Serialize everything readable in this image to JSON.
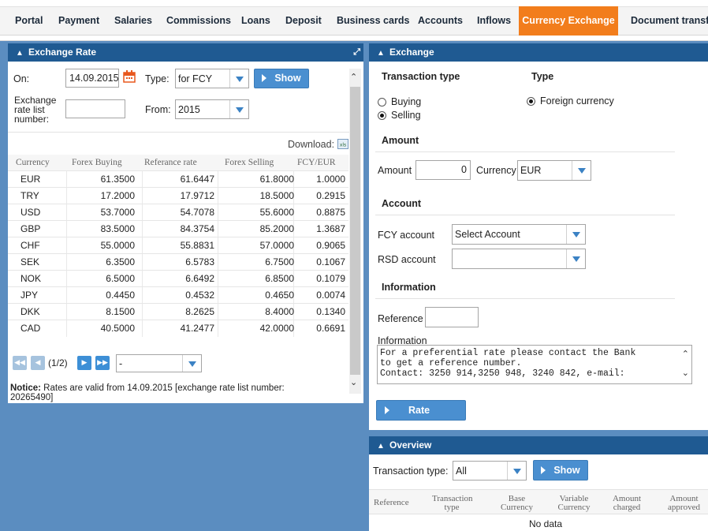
{
  "nav": {
    "items": [
      "Portal",
      "Payment",
      "Salaries",
      "Commissions",
      "Loans",
      "Deposit",
      "Business cards",
      "Accounts",
      "Inflows",
      "Currency Exchange",
      "Document transfer"
    ],
    "active": "Currency Exchange"
  },
  "exchange_rate": {
    "title": "Exchange Rate",
    "on_label": "On:",
    "date": "14.09.2015",
    "type_label": "Type:",
    "type_value": "for FCY",
    "show_label": "Show",
    "list_label_1": "Exchange",
    "list_label_2": "rate list",
    "list_label_3": "number:",
    "list_number": "",
    "from_label": "From:",
    "from_value": "2015",
    "download_label": "Download:",
    "columns": [
      "Currency",
      "Forex Buying",
      "Referance rate",
      "Forex Selling",
      "FCY/EUR"
    ],
    "rows": [
      [
        "EUR",
        "61.3500",
        "61.6447",
        "61.8000",
        "1.0000"
      ],
      [
        "TRY",
        "17.2000",
        "17.9712",
        "18.5000",
        "0.2915"
      ],
      [
        "USD",
        "53.7000",
        "54.7078",
        "55.6000",
        "0.8875"
      ],
      [
        "GBP",
        "83.5000",
        "84.3754",
        "85.2000",
        "1.3687"
      ],
      [
        "CHF",
        "55.0000",
        "55.8831",
        "57.0000",
        "0.9065"
      ],
      [
        "SEK",
        "6.3500",
        "6.5783",
        "6.7500",
        "0.1067"
      ],
      [
        "NOK",
        "6.5000",
        "6.6492",
        "6.8500",
        "0.1079"
      ],
      [
        "JPY",
        "0.4450",
        "0.4532",
        "0.4650",
        "0.0074"
      ],
      [
        "DKK",
        "8.1500",
        "8.2625",
        "8.4000",
        "0.1340"
      ],
      [
        "CAD",
        "40.5000",
        "41.2477",
        "42.0000",
        "0.6691"
      ]
    ],
    "pager_text": "(1/2)",
    "page_size": "-",
    "notice_bold": "Notice:",
    "notice_text_1": " Rates are valid from 14.09.2015 [exchange rate list number:",
    "notice_text_2": "20265490]"
  },
  "exchange": {
    "title": "Exchange",
    "transaction_type_label": "Transaction type",
    "type_label": "Type",
    "buying_label": "Buying",
    "selling_label": "Selling",
    "foreign_currency_label": "Foreign currency",
    "amount_section": "Amount",
    "amount_label": "Amount",
    "amount_value": "0",
    "currency_label": "Currency",
    "currency_value": "EUR",
    "account_section": "Account",
    "fcy_account_label": "FCY account",
    "fcy_account_value": "Select Account",
    "rsd_account_label": "RSD account",
    "rsd_account_value": "",
    "information_section": "Information",
    "reference_label": "Reference",
    "reference_value": "",
    "information_label": "Information",
    "info_line_1": "For a preferential rate please contact the Bank",
    "info_line_2": "to get a reference number.",
    "info_line_3": "Contact: 3250 914,3250 948, 3240 842, e-mail:",
    "rate_button": "Rate"
  },
  "overview": {
    "title": "Overview",
    "transaction_type_label": "Transaction type:",
    "transaction_type_value": "All",
    "show_label": "Show",
    "columns": [
      "Reference",
      "Transaction type",
      "Base Currency",
      "Variable Currency",
      "Amount charged",
      "Amount approved"
    ],
    "no_data": "No data"
  },
  "colors": {
    "background": "#5b8dc0",
    "panel_header": "#1f5a92",
    "nav_active": "#f27d1c",
    "button": "#4a8fd0"
  }
}
